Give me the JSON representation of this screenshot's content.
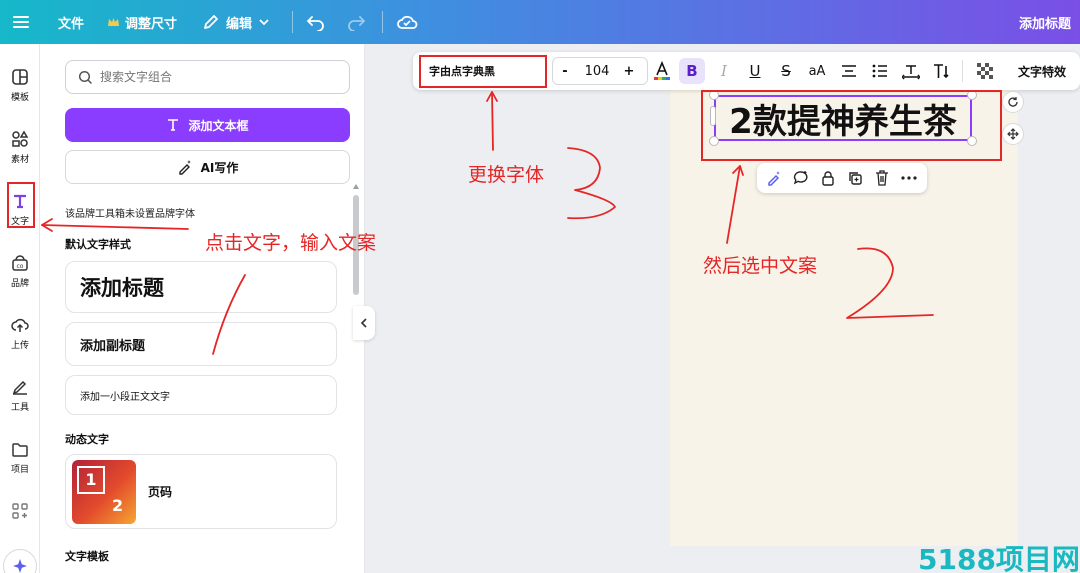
{
  "topbar": {
    "file": "文件",
    "resize": "调整尺寸",
    "edit": "编辑",
    "doc_title": "添加标题"
  },
  "rail": [
    {
      "label": "模板",
      "icon": "template-icon"
    },
    {
      "label": "素材",
      "icon": "elements-icon"
    },
    {
      "label": "文字",
      "icon": "text-icon"
    },
    {
      "label": "品牌",
      "icon": "brand-icon"
    },
    {
      "label": "上传",
      "icon": "upload-icon"
    },
    {
      "label": "工具",
      "icon": "tools-icon"
    },
    {
      "label": "项目",
      "icon": "folder-icon"
    }
  ],
  "panel": {
    "search_placeholder": "搜索文字组合",
    "add_textbox": "添加文本框",
    "ai_write": "AI写作",
    "brand_notice": "该品牌工具箱未设置品牌字体",
    "default_styles_title": "默认文字样式",
    "heading": "添加标题",
    "subheading": "添加副标题",
    "body": "添加一小段正文文字",
    "dynamic_title": "动态文字",
    "dynamic_item": "页码",
    "page_num_1": "1",
    "page_num_2": "2",
    "templates_title": "文字模板"
  },
  "toolbar": {
    "font_name": "字由点字典黑",
    "font_size": "104",
    "minus": "-",
    "plus": "+",
    "bold": "B",
    "italic": "I",
    "underline": "U",
    "strike": "S",
    "case": "aA",
    "effects": "文字特效"
  },
  "canvas": {
    "text": "2款提神养生茶"
  },
  "annotations": {
    "click_text": "点击文字，输入文案",
    "select_text": "然后选中文案",
    "change_font": "更换字体"
  },
  "watermark": "5188项目网",
  "colors": {
    "accent": "#8b3dff",
    "annotation": "#e52626"
  }
}
